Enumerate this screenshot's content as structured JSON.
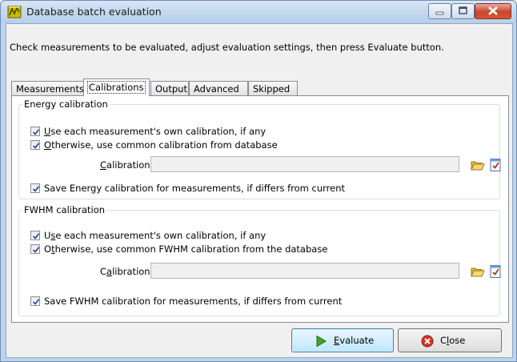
{
  "window": {
    "title": "Database batch evaluation"
  },
  "instructions": "Check measurements to be evaluated, adjust evaluation settings, then press Evaluate button.",
  "tabs": [
    {
      "label": "Measurements",
      "active": false
    },
    {
      "label": "Calibrations",
      "active": true
    },
    {
      "label": "Output",
      "active": false
    },
    {
      "label": "Advanced",
      "active": false
    },
    {
      "label": "Skipped",
      "active": false
    }
  ],
  "energy": {
    "legend": "Energy calibration",
    "own_calibration": {
      "mnemonic": "U",
      "rest": "se each measurement's own calibration, if any",
      "checked": true
    },
    "common_calibration": {
      "mnemonic": "O",
      "rest": "therwise, use common calibration from database",
      "checked": true
    },
    "calibration_label_mnemonic": "C",
    "calibration_label_rest": "alibration:",
    "calibration_value": "",
    "save": {
      "label": "Save Energy calibration for measurements, if differs from current",
      "checked": true
    }
  },
  "fwhm": {
    "legend": "FWHM calibration",
    "own_calibration": {
      "before": "U",
      "mnemonic": "s",
      "rest": "e each measurement's own calibration, if any",
      "checked": true
    },
    "common_calibration": {
      "before": "O",
      "mnemonic": "t",
      "rest": "herwise, use common FWHM calibration from the database",
      "checked": true
    },
    "calibration_label_before": "C",
    "calibration_label_mnemonic": "a",
    "calibration_label_rest": "libration:",
    "calibration_value": "",
    "save": {
      "label": "Save FWHM calibration for measurements, if differs from current",
      "checked": true
    }
  },
  "buttons": {
    "evaluate": {
      "mnemonic": "E",
      "rest": "valuate"
    },
    "close": {
      "before": "C",
      "mnemonic": "l",
      "rest": "ose"
    }
  },
  "icons": {
    "app": "database-eval-icon",
    "folder": "folder-open-icon",
    "edit": "edit-document-icon",
    "evaluate": "play-arrow-icon",
    "close": "close-circle-icon"
  },
  "colors": {
    "title_bar": "#c4d8ee",
    "close_button": "#c8462c",
    "accent_button": "#bee6fd"
  }
}
